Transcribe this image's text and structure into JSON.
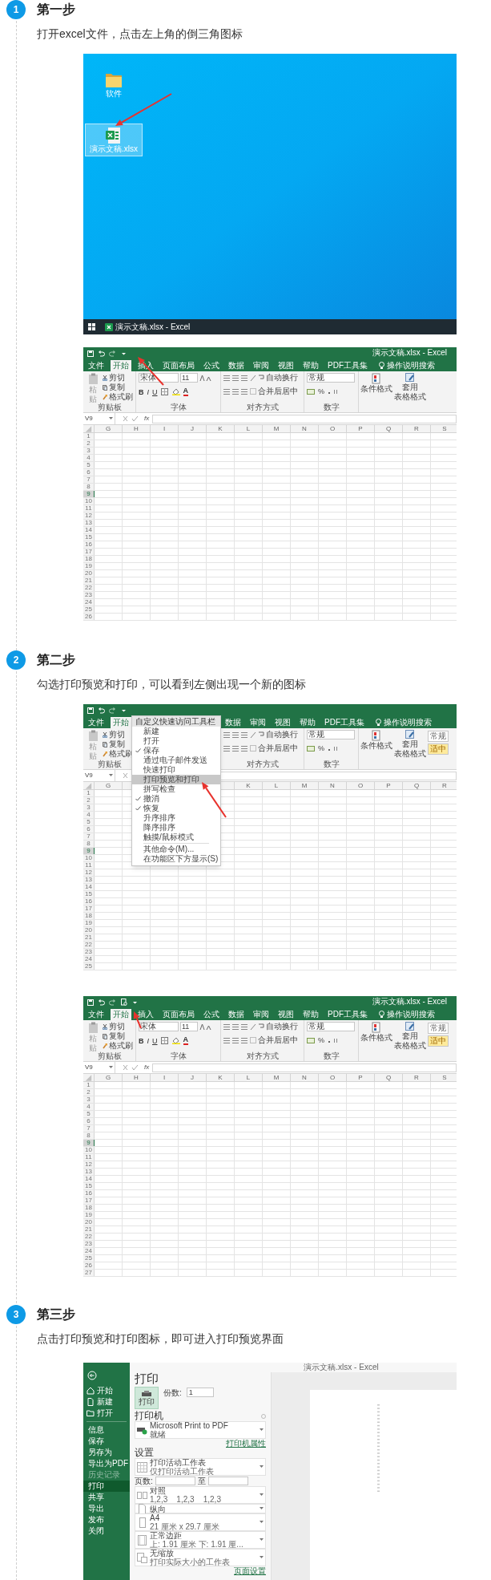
{
  "steps": [
    {
      "number": "1",
      "title": "第一步",
      "description": "打开excel文件，点击左上角的倒三角图标",
      "images": [
        {
          "kind": "desktop",
          "icons": [
            {
              "kind": "folder",
              "label": "软件",
              "selected": false
            },
            {
              "kind": "spreadsheet",
              "label": "演示文稿.xlsx",
              "selected": true
            }
          ],
          "taskbar": {
            "app_label": "演示文稿.xlsx - Excel"
          }
        },
        {
          "kind": "excel",
          "title": "演示文稿.xlsx - Excel",
          "print_preview_button": false,
          "tabs": [
            {
              "label": "文件",
              "selected": false
            },
            {
              "label": "开始",
              "selected": true
            },
            {
              "label": "插入",
              "selected": false
            },
            {
              "label": "页面布局",
              "selected": false
            },
            {
              "label": "公式",
              "selected": false
            },
            {
              "label": "数据",
              "selected": false
            },
            {
              "label": "审阅",
              "selected": false
            },
            {
              "label": "视图",
              "selected": false
            },
            {
              "label": "帮助",
              "selected": false
            },
            {
              "label": "PDF工具集",
              "selected": false
            }
          ],
          "search_label": "操作说明搜索",
          "clipboard": {
            "paste": "粘贴",
            "cut": "剪切",
            "copy": "复制",
            "painter": "格式刷",
            "label": "剪贴板"
          },
          "font": {
            "name": "宋体",
            "size": "11",
            "format_buttons": [
              "B",
              "I",
              "U"
            ],
            "color_letter": "A",
            "label": "字体"
          },
          "alignment": {
            "wrap": "自动换行",
            "merge": "合并后居中",
            "label": "对齐方式"
          },
          "number": {
            "format": "常规",
            "percent": "%",
            "label": "数字"
          },
          "styles": {
            "conditional": "条件格式",
            "table": [
              "套用",
              "表格格式"
            ]
          },
          "name_box": "V9",
          "fx": "fx",
          "columns": [
            "G",
            "H",
            "I",
            "J",
            "K",
            "L",
            "M",
            "N",
            "O",
            "P",
            "Q",
            "R",
            "S"
          ],
          "rows": [
            {
              "label": "1",
              "selected": false
            },
            {
              "label": "2",
              "selected": false
            },
            {
              "label": "3",
              "selected": false
            },
            {
              "label": "4",
              "selected": false
            },
            {
              "label": "5",
              "selected": false
            },
            {
              "label": "6",
              "selected": false
            },
            {
              "label": "7",
              "selected": false
            },
            {
              "label": "8",
              "selected": false
            },
            {
              "label": "9",
              "selected": true
            },
            {
              "label": "10",
              "selected": false
            },
            {
              "label": "11",
              "selected": false
            },
            {
              "label": "12",
              "selected": false
            },
            {
              "label": "13",
              "selected": false
            },
            {
              "label": "14",
              "selected": false
            },
            {
              "label": "15",
              "selected": false
            },
            {
              "label": "16",
              "selected": false
            },
            {
              "label": "17",
              "selected": false
            },
            {
              "label": "18",
              "selected": false
            },
            {
              "label": "19",
              "selected": false
            },
            {
              "label": "20",
              "selected": false
            },
            {
              "label": "21",
              "selected": false
            },
            {
              "label": "22",
              "selected": false
            },
            {
              "label": "23",
              "selected": false
            },
            {
              "label": "24",
              "selected": false
            },
            {
              "label": "25",
              "selected": false
            },
            {
              "label": "26",
              "selected": false
            }
          ]
        }
      ]
    },
    {
      "number": "2",
      "title": "第二步",
      "description": "勾选打印预览和打印，可以看到左侧出现一个新的图标",
      "images": [
        {
          "kind": "excel",
          "print_preview_button": false,
          "tabs": [
            {
              "label": "文件",
              "selected": false
            },
            {
              "label": "开始",
              "selected": true
            },
            {
              "label": "数据",
              "selected": false
            },
            {
              "label": "审阅",
              "selected": false
            },
            {
              "label": "视图",
              "selected": false
            },
            {
              "label": "帮助",
              "selected": false
            },
            {
              "label": "PDF工具集",
              "selected": false
            }
          ],
          "search_label": "操作说明搜索",
          "clipboard": {
            "paste": "粘贴",
            "cut": "剪切",
            "copy": "复制",
            "painter": "格式刷",
            "label": "剪贴板"
          },
          "alignment": {
            "wrap": "自动换行",
            "merge": "合并后居中",
            "label": "对齐方式"
          },
          "number": {
            "format": "常规",
            "percent": "%",
            "label": "数字"
          },
          "styles": {
            "conditional": "条件格式",
            "table": [
              "套用",
              "表格格式"
            ],
            "style_boxes": [
              "常规",
              "适中"
            ]
          },
          "name_box": "V9",
          "columns": [
            "G",
            "K",
            "L",
            "M",
            "N",
            "O",
            "P",
            "Q",
            "R"
          ],
          "rows": [
            {
              "label": "1",
              "selected": false
            },
            {
              "label": "2",
              "selected": false
            },
            {
              "label": "3",
              "selected": false
            },
            {
              "label": "4",
              "selected": false
            },
            {
              "label": "5",
              "selected": false
            },
            {
              "label": "6",
              "selected": false
            },
            {
              "label": "7",
              "selected": false
            },
            {
              "label": "8",
              "selected": false
            },
            {
              "label": "9",
              "selected": true
            },
            {
              "label": "10",
              "selected": false
            },
            {
              "label": "11",
              "selected": false
            },
            {
              "label": "12",
              "selected": false
            },
            {
              "label": "13",
              "selected": false
            },
            {
              "label": "14",
              "selected": false
            },
            {
              "label": "15",
              "selected": false
            },
            {
              "label": "16",
              "selected": false
            },
            {
              "label": "17",
              "selected": false
            },
            {
              "label": "18",
              "selected": false
            },
            {
              "label": "19",
              "selected": false
            },
            {
              "label": "20",
              "selected": false
            },
            {
              "label": "21",
              "selected": false
            },
            {
              "label": "22",
              "selected": false
            },
            {
              "label": "23",
              "selected": false
            },
            {
              "label": "24",
              "selected": false
            },
            {
              "label": "25",
              "selected": false
            }
          ],
          "menu": {
            "title": "自定义快速访问工具栏",
            "items": [
              {
                "label": "新建",
                "checked": false,
                "selected": false
              },
              {
                "label": "打开",
                "checked": false,
                "selected": false
              },
              {
                "label": "保存",
                "checked": true,
                "selected": false
              },
              {
                "label": "通过电子邮件发送",
                "checked": false,
                "selected": false
              },
              {
                "label": "快速打印",
                "checked": false,
                "selected": false
              },
              {
                "label": "打印预览和打印",
                "checked": false,
                "selected": true
              },
              {
                "label": "拼写检查",
                "checked": false,
                "selected": false
              },
              {
                "label": "撤消",
                "checked": true,
                "selected": false
              },
              {
                "label": "恢复",
                "checked": true,
                "selected": false
              },
              {
                "label": "升序排序",
                "checked": false,
                "selected": false
              },
              {
                "label": "降序排序",
                "checked": false,
                "selected": false
              },
              {
                "label": "触摸/鼠标模式",
                "checked": false,
                "selected": false
              }
            ],
            "extra_items": [
              "其他命令(M)...",
              "在功能区下方显示(S)"
            ]
          }
        },
        {
          "kind": "excel",
          "title": "演示文稿.xlsx - Excel",
          "print_preview_button": true,
          "tabs": [
            {
              "label": "文件",
              "selected": false
            },
            {
              "label": "开始",
              "selected": true
            },
            {
              "label": "插入",
              "selected": false
            },
            {
              "label": "页面布局",
              "selected": false
            },
            {
              "label": "公式",
              "selected": false
            },
            {
              "label": "数据",
              "selected": false
            },
            {
              "label": "审阅",
              "selected": false
            },
            {
              "label": "视图",
              "selected": false
            },
            {
              "label": "帮助",
              "selected": false
            },
            {
              "label": "PDF工具集",
              "selected": false
            }
          ],
          "search_label": "操作说明搜索",
          "clipboard": {
            "paste": "粘贴",
            "cut": "剪切",
            "copy": "复制",
            "painter": "格式刷",
            "label": "剪贴板"
          },
          "font": {
            "name": "宋体",
            "size": "11",
            "format_buttons": [
              "B",
              "I",
              "U"
            ],
            "color_letter": "A",
            "label": "字体"
          },
          "alignment": {
            "wrap": "自动换行",
            "merge": "合并后居中",
            "label": "对齐方式"
          },
          "number": {
            "format": "常规",
            "percent": "%",
            "label": "数字"
          },
          "styles": {
            "conditional": "条件格式",
            "table": [
              "套用",
              "表格格式"
            ],
            "style_boxes": [
              "常规",
              "适中"
            ]
          },
          "name_box": "V9",
          "fx": "fx",
          "columns": [
            "G",
            "H",
            "I",
            "J",
            "K",
            "L",
            "M",
            "N",
            "O",
            "P",
            "Q",
            "R",
            "S"
          ],
          "rows": [
            {
              "label": "1",
              "selected": false
            },
            {
              "label": "2",
              "selected": false
            },
            {
              "label": "3",
              "selected": false
            },
            {
              "label": "4",
              "selected": false
            },
            {
              "label": "5",
              "selected": false
            },
            {
              "label": "6",
              "selected": false
            },
            {
              "label": "7",
              "selected": false
            },
            {
              "label": "8",
              "selected": false
            },
            {
              "label": "9",
              "selected": true
            },
            {
              "label": "10",
              "selected": false
            },
            {
              "label": "11",
              "selected": false
            },
            {
              "label": "12",
              "selected": false
            },
            {
              "label": "13",
              "selected": false
            },
            {
              "label": "14",
              "selected": false
            },
            {
              "label": "15",
              "selected": false
            },
            {
              "label": "16",
              "selected": false
            },
            {
              "label": "17",
              "selected": false
            },
            {
              "label": "18",
              "selected": false
            },
            {
              "label": "19",
              "selected": false
            },
            {
              "label": "20",
              "selected": false
            },
            {
              "label": "21",
              "selected": false
            },
            {
              "label": "22",
              "selected": false
            },
            {
              "label": "23",
              "selected": false
            },
            {
              "label": "24",
              "selected": false
            },
            {
              "label": "25",
              "selected": false
            },
            {
              "label": "26",
              "selected": false
            },
            {
              "label": "27",
              "selected": false
            }
          ]
        }
      ]
    },
    {
      "number": "3",
      "title": "第三步",
      "description": "点击打印预览和打印图标，即可进入打印预览界面",
      "images": [
        {
          "kind": "print",
          "window_title": "演示文稿.xlsx - Excel",
          "nav": [
            {
              "kind": "icon",
              "label": "开始",
              "selected": false,
              "disabled": false
            },
            {
              "kind": "icon",
              "label": "新建",
              "selected": false,
              "disabled": false
            },
            {
              "kind": "icon",
              "label": "打开",
              "selected": false,
              "disabled": false
            },
            {
              "kind": "text",
              "label": "信息",
              "selected": false,
              "disabled": false
            },
            {
              "kind": "text",
              "label": "保存",
              "selected": false,
              "disabled": false
            },
            {
              "kind": "text",
              "label": "另存为",
              "selected": false,
              "disabled": false
            },
            {
              "kind": "text",
              "label": "导出为PDF",
              "selected": false,
              "disabled": false
            },
            {
              "kind": "text",
              "label": "历史记录",
              "selected": false,
              "disabled": true
            },
            {
              "kind": "text",
              "label": "打印",
              "selected": true,
              "disabled": false
            },
            {
              "kind": "text",
              "label": "共享",
              "selected": false,
              "disabled": false
            },
            {
              "kind": "text",
              "label": "导出",
              "selected": false,
              "disabled": false
            },
            {
              "kind": "text",
              "label": "发布",
              "selected": false,
              "disabled": false
            },
            {
              "kind": "text",
              "label": "关闭",
              "selected": false,
              "disabled": false
            }
          ],
          "heading": "打印",
          "print_button": "打印",
          "copies_label": "份数:",
          "copies_value": "1",
          "printer_heading": "打印机",
          "printer": {
            "name": "Microsoft Print to PDF",
            "status": "就绪"
          },
          "printer_link": "打印机属性",
          "settings_heading": "设置",
          "settings": [
            {
              "kind": "dropdown",
              "title": "打印活动工作表",
              "subtitle": "仅打印活动工作表"
            },
            {
              "kind": "range",
              "label": "页数:",
              "to": "至"
            },
            {
              "kind": "dropdown",
              "title": "对照",
              "subtitle": "1,2,3    1,2,3    1,2,3"
            },
            {
              "kind": "dropdown",
              "title": "纵向"
            },
            {
              "kind": "dropdown",
              "title": "A4",
              "subtitle": "21 厘米 x 29.7 厘米"
            },
            {
              "kind": "dropdown",
              "title": "正常边距",
              "subtitle": "上: 1.91 厘米 下: 1.91 厘..."
            },
            {
              "kind": "dropdown",
              "title": "无缩放",
              "subtitle": "打印实际大小的工作表"
            }
          ],
          "page_setup_link": "页面设置"
        }
      ]
    }
  ]
}
